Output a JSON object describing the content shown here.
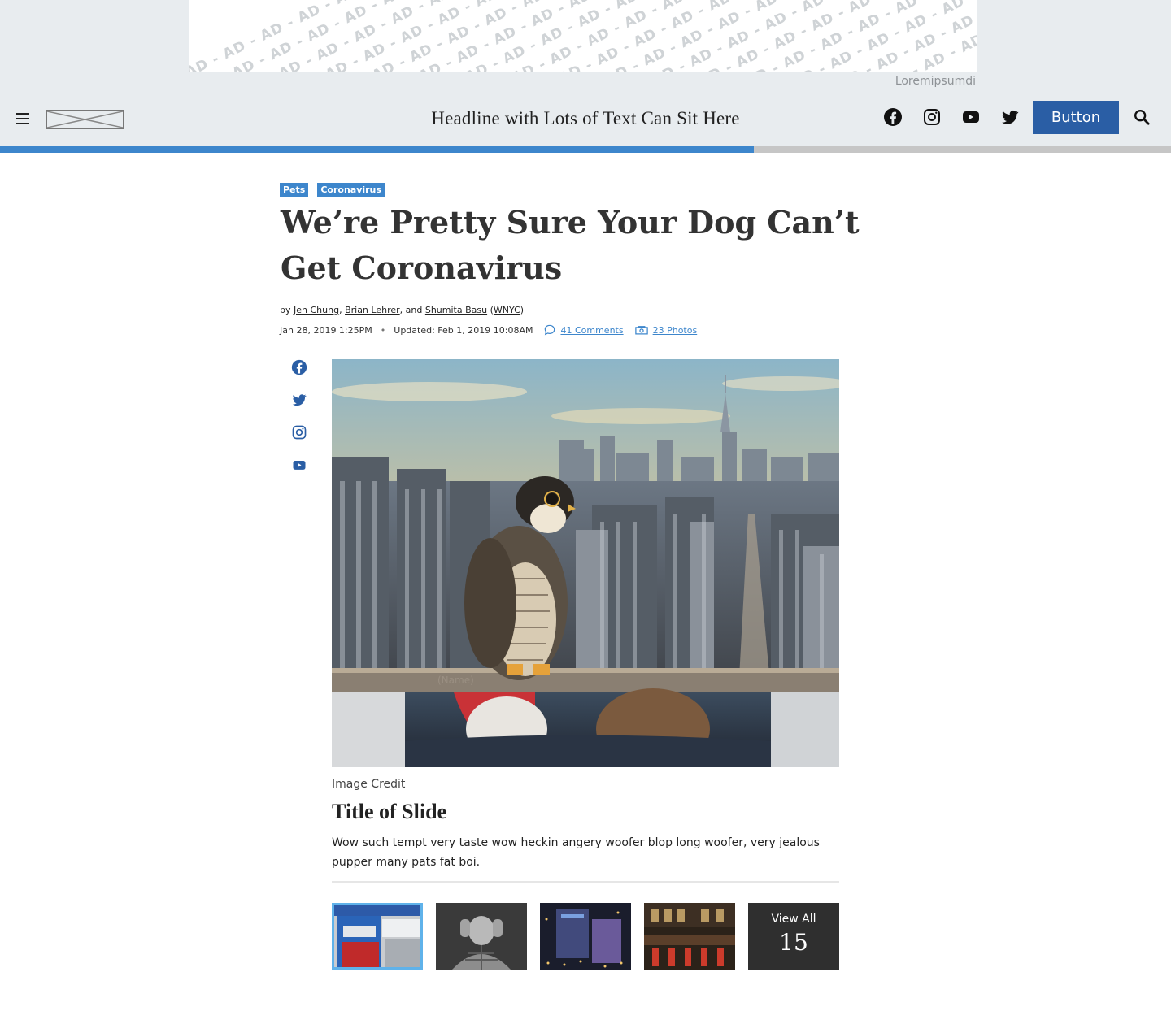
{
  "ad": {
    "pattern_text": "AD - AD - AD - AD - AD - AD - AD - AD - AD - AD - AD - AD - AD - AD - AD - AD - AD - AD - AD - AD - AD - AD - AD - AD - AD - AD - AD",
    "label": "Loremipsumdi"
  },
  "header": {
    "headline": "Headline with Lots of Text Can Sit Here",
    "button_label": "Button",
    "progress_fraction": 0.644,
    "colors": {
      "button": "#2a5ea5",
      "progress_fill": "#3d86cc",
      "progress_track": "#c6c6c6"
    },
    "icons": [
      "menu-icon",
      "logo-placeholder",
      "facebook-icon",
      "instagram-icon",
      "youtube-icon",
      "twitter-icon",
      "search-icon"
    ]
  },
  "article": {
    "tags": [
      "Pets",
      "Coronavirus"
    ],
    "title": "We’re Pretty Sure Your Dog Can’t Get Coronavirus",
    "byline": {
      "prefix": "by ",
      "authors": [
        "Jen Chung",
        "Brian Lehrer",
        "Shumita Basu"
      ],
      "sep1": ", ",
      "sep2": ", and ",
      "org": "WNYC"
    },
    "published": "Jan 28, 2019 1:25PM",
    "updated": "Updated: Feb 1, 2019 10:08AM",
    "comments": "41 Comments",
    "photos": "23 Photos"
  },
  "share_icons": [
    "facebook-icon",
    "twitter-icon",
    "instagram-icon",
    "youtube-icon"
  ],
  "slide": {
    "image_overlay_text": "(Name)",
    "credit": "Image Credit",
    "title": "Title of Slide",
    "text": "Wow such tempt very taste wow heckin angery woofer blop long woofer, very jealous pupper many pats fat boi."
  },
  "gallery": {
    "view_all_label": "View All",
    "view_all_count": "15"
  }
}
